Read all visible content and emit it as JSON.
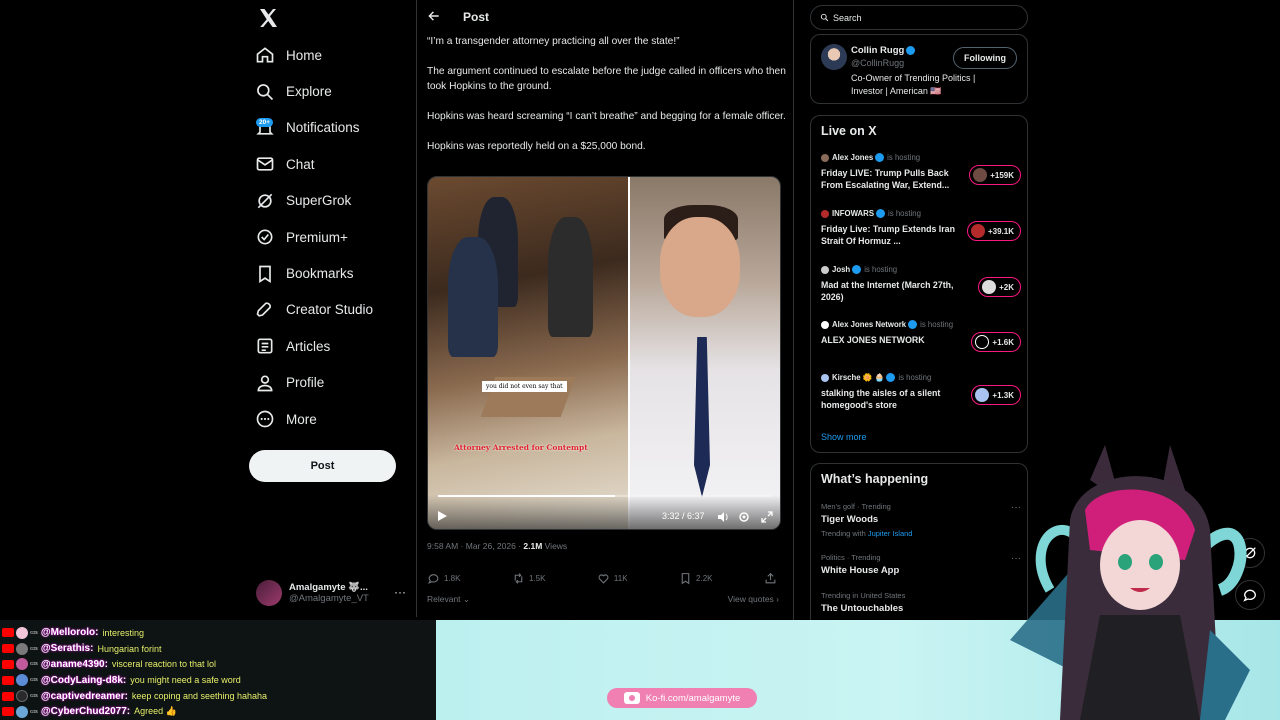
{
  "sidebar": {
    "logo": "x-logo-icon",
    "nav": [
      {
        "label": "Home",
        "icon": "home-icon"
      },
      {
        "label": "Explore",
        "icon": "search-icon"
      },
      {
        "label": "Notifications",
        "icon": "bell-icon",
        "badge": "20+"
      },
      {
        "label": "Chat",
        "icon": "mail-icon"
      },
      {
        "label": "SuperGrok",
        "icon": "grok-icon"
      },
      {
        "label": "Premium+",
        "icon": "premium-icon"
      },
      {
        "label": "Bookmarks",
        "icon": "bookmark-icon"
      },
      {
        "label": "Creator Studio",
        "icon": "rocket-icon"
      },
      {
        "label": "Articles",
        "icon": "articles-icon"
      },
      {
        "label": "Profile",
        "icon": "person-icon"
      },
      {
        "label": "More",
        "icon": "more-circle-icon"
      }
    ],
    "post_button": "Post",
    "account": {
      "name": "Amalgamyte 🐺...",
      "handle": "@Amalgamyte_VT"
    }
  },
  "main": {
    "header_title": "Post",
    "paragraphs": [
      "“I’m a transgender attorney practicing all over the state!”",
      "The argument continued to escalate before the judge called in officers who then took Hopkins to the ground.",
      "Hopkins was heard screaming “I can’t breathe” and begging for a female officer.",
      "Hopkins was reportedly held on a $25,000 bond."
    ],
    "video": {
      "caption_white": "you did not even say that",
      "caption_red": "Attorney Arrested for Contempt",
      "time": "3:32 / 6:37",
      "progress": 0.53
    },
    "meta": {
      "time": "9:58 AM · Mar 26, 2026 · ",
      "views_count": "2.1M",
      "views_label": " Views"
    },
    "actions": {
      "replies": "1.8K",
      "reposts": "1.5K",
      "likes": "11K",
      "bookmarks": "2.2K"
    },
    "relevant": "Relevant",
    "view_quotes": "View quotes"
  },
  "right": {
    "search_placeholder": "Search",
    "follow_card": {
      "name": "Collin Rugg",
      "handle": "@CollinRugg",
      "bio": "Co-Owner of Trending Politics | Investor | American 🇺🇸",
      "button": "Following"
    },
    "live": {
      "title": "Live on X",
      "hosting_label": "is hosting",
      "items": [
        {
          "host": "Alex Jones",
          "title": "Friday LIVE: Trump Pulls Back From Escalating War, Extend...",
          "count": "+159K"
        },
        {
          "host": "INFOWARS",
          "title": "Friday Live: Trump Extends Iran Strait Of Hormuz ...",
          "count": "+39.1K"
        },
        {
          "host": "Josh",
          "title": "Mad at the Internet (March 27th, 2026)",
          "count": "+2K"
        },
        {
          "host": "Alex Jones Network",
          "title": "ALEX JONES NETWORK",
          "count": "+1.6K"
        },
        {
          "host": "Kirsche 🌼 🧁",
          "title": "stalking the aisles of a silent homegood's store",
          "count": "+1.3K"
        }
      ],
      "show_more": "Show more"
    },
    "happening": {
      "title": "What’s happening",
      "trends": [
        {
          "category": "Men's golf · Trending",
          "name": "Tiger Woods",
          "with_label": "Trending with",
          "with": "Jupiter Island"
        },
        {
          "category": "Politics · Trending",
          "name": "White House App"
        },
        {
          "category": "Trending in United States",
          "name": "The Untouchables"
        }
      ]
    }
  },
  "stream": {
    "chat": [
      {
        "name": "@Mellorolo:",
        "msg": "interesting",
        "color": "#f2c6d8"
      },
      {
        "name": "@Serathis:",
        "msg": "Hungarian forint",
        "color": "#7a7a7a"
      },
      {
        "name": "@aname4390:",
        "msg": "visceral reaction to that lol",
        "color": "#c05a9a"
      },
      {
        "name": "@CodyLaing-d8k:",
        "msg": "you might need a safe word",
        "color": "#5c8cd6"
      },
      {
        "name": "@captivedreamer:",
        "msg": "keep coping and seething hahaha",
        "color": "#2a2a2a"
      },
      {
        "name": "@CyberChud2077:",
        "msg": "Agreed 👍",
        "color": "#6aa7d6"
      }
    ],
    "chat_tag": "ɢɪꜱ",
    "kofi": "Ko-fi.com/amalgamyte"
  }
}
